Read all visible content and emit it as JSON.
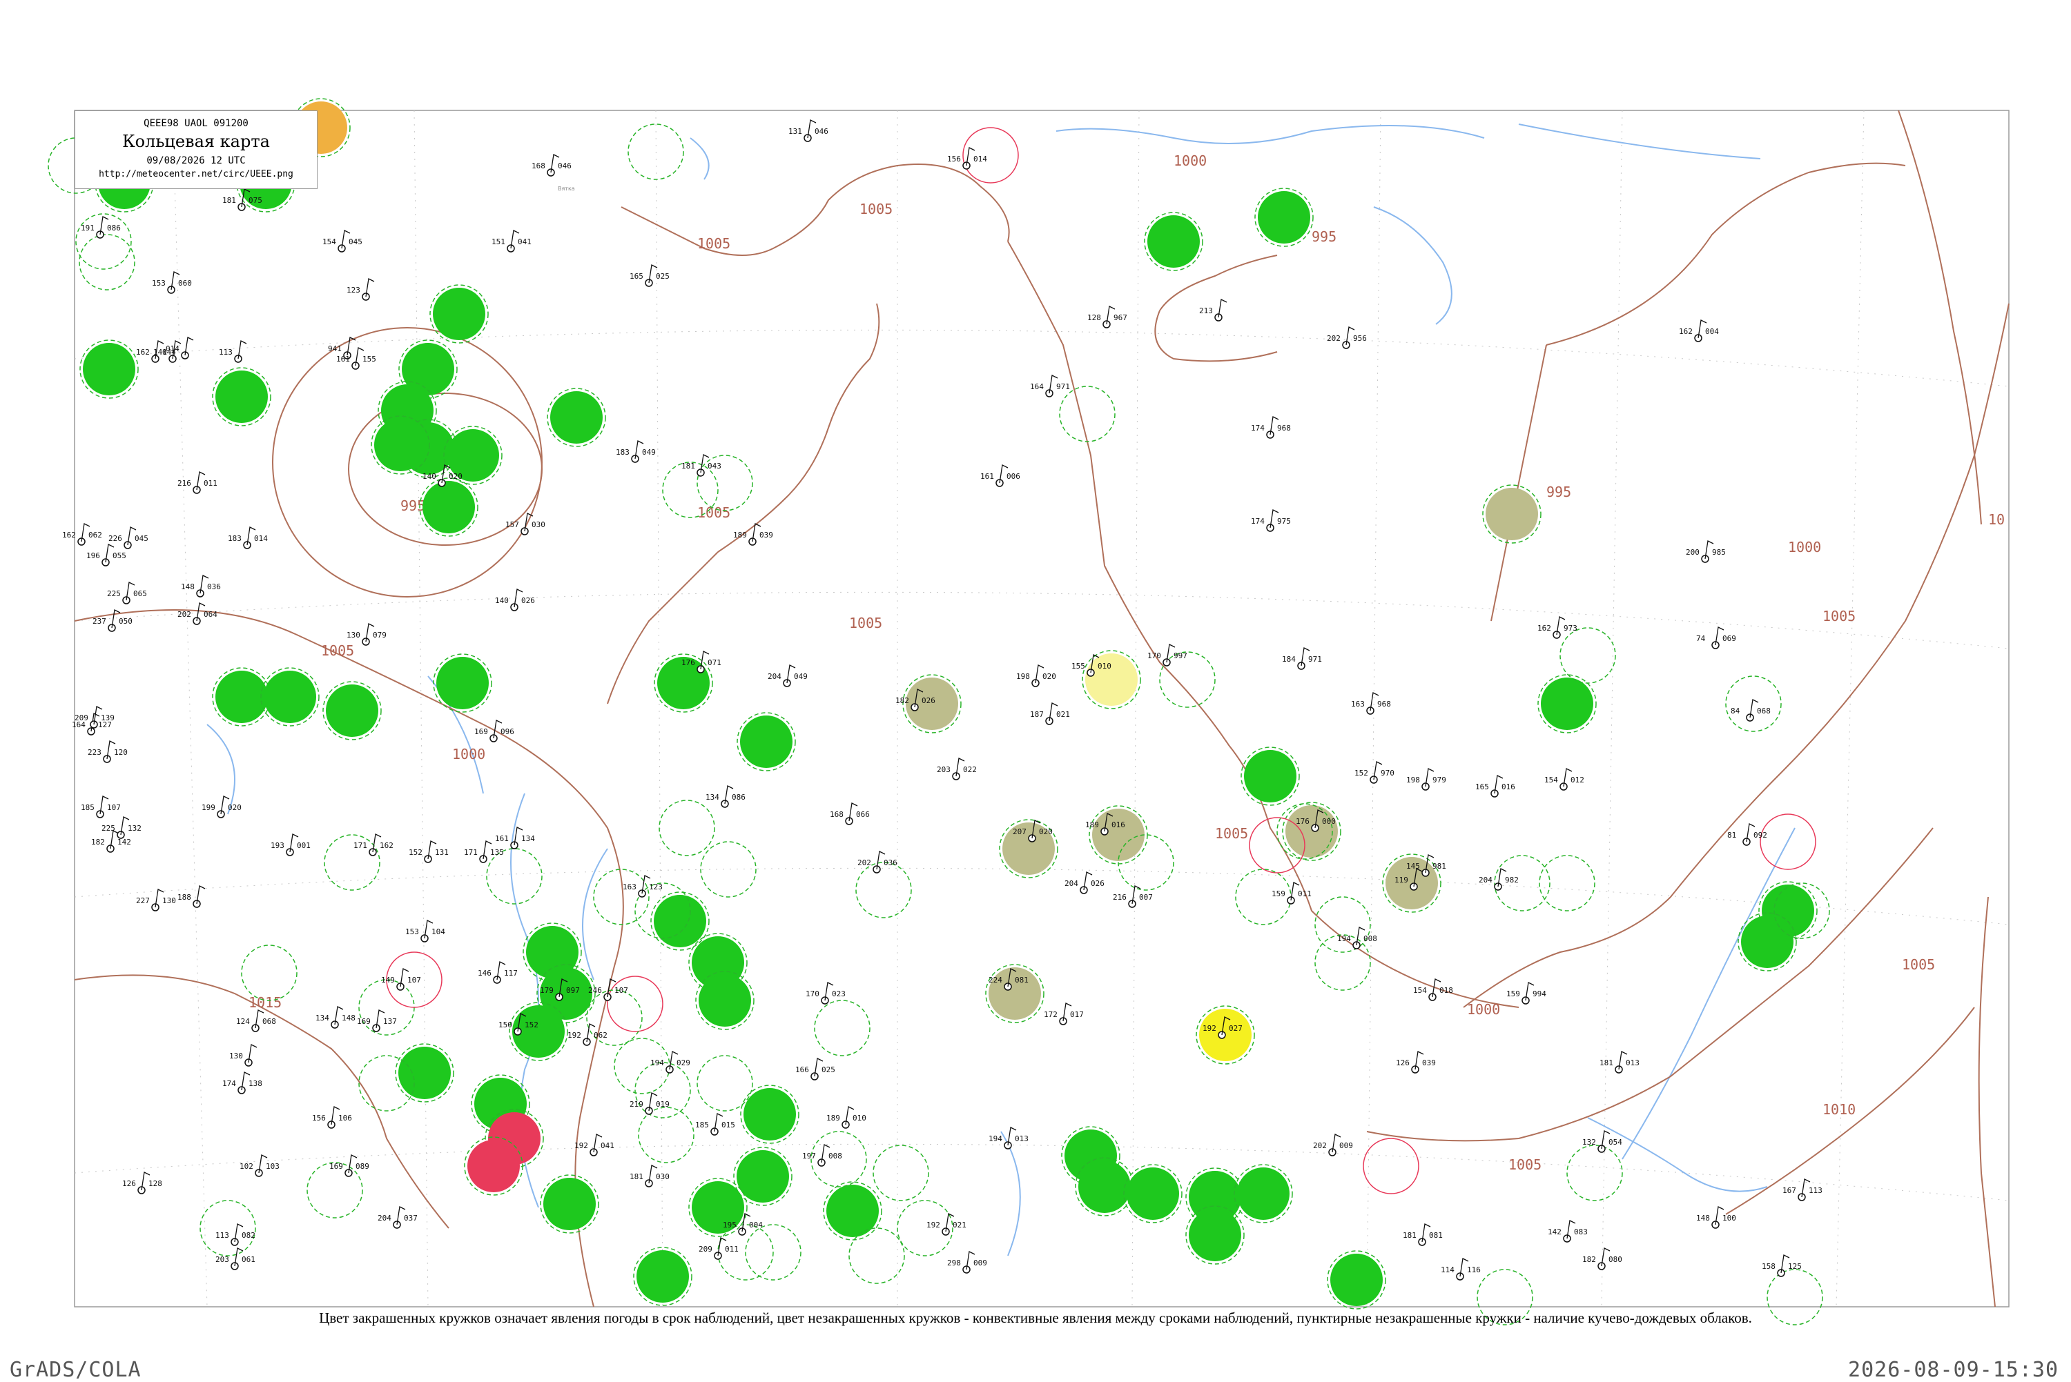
{
  "header": {
    "code_line": "QEEE98  UAOL  091200",
    "title": "Кольцевая карта",
    "date_line": "09/08/2026 12 UTC",
    "url": "http://meteocenter.net/circ/UEEE.png"
  },
  "caption": "Цвет закрашенных кружков означает явления погоды в срок наблюдений, цвет незакрашенных кружков - конвективные явления между сроками наблюдений, пунктирные незакрашенные кружки - наличие кучево-дождевых облаков.",
  "footer": {
    "left": "GrADS/COLA",
    "right": "2026-08-09-15:30"
  },
  "colors": {
    "rain": "#1ec81e",
    "shower_light": "#bdbd8c",
    "fog_yellow": "#f5f020",
    "pale_yellow": "#f7f39a",
    "orange": "#f0b040",
    "red": "#e83a5a",
    "isobar": "#b0705a",
    "water": "#8ab8ee",
    "dash_green": "#29b429"
  },
  "isobar_labels": [
    "1000",
    "1005",
    "1005",
    "1005",
    "1005",
    "1005",
    "1000",
    "995",
    "995",
    "1005",
    "1000",
    "1010",
    "1005",
    "1005",
    "995",
    "1015",
    "1000",
    "1005",
    "10"
  ],
  "stations": [
    {
      "t": "181",
      "p": "075",
      "name": ""
    },
    {
      "t": "191",
      "p": "086",
      "name": ""
    },
    {
      "t": "153",
      "p": "060",
      "name": ""
    },
    {
      "t": "162",
      "p": "044",
      "name": ""
    },
    {
      "t": "154",
      "p": "045",
      "name": ""
    },
    {
      "t": "165",
      "p": "065",
      "name": ""
    },
    {
      "t": "168",
      "p": "046",
      "name": "Вятка"
    },
    {
      "t": "131",
      "p": "046",
      "name": ""
    },
    {
      "t": "156",
      "p": "014",
      "name": ""
    },
    {
      "t": "151",
      "p": "041",
      "name": ""
    },
    {
      "t": "165",
      "p": "025",
      "name": ""
    },
    {
      "t": "941",
      "p": "",
      "name": ""
    },
    {
      "t": "183",
      "p": "049",
      "name": ""
    },
    {
      "t": "181",
      "p": "043",
      "name": ""
    },
    {
      "t": "189",
      "p": "039",
      "name": ""
    },
    {
      "t": "161",
      "p": "006",
      "name": ""
    },
    {
      "t": "164",
      "p": "971",
      "name": ""
    },
    {
      "t": "128",
      "p": "967",
      "name": ""
    },
    {
      "t": "213",
      "p": "",
      "name": ""
    },
    {
      "t": "202",
      "p": "956",
      "name": ""
    },
    {
      "t": "162",
      "p": "004",
      "name": ""
    },
    {
      "t": "174",
      "p": "968",
      "name": ""
    },
    {
      "t": "174",
      "p": "975",
      "name": ""
    },
    {
      "t": "200",
      "p": "985",
      "name": ""
    },
    {
      "t": "216",
      "p": "011",
      "name": ""
    },
    {
      "t": "183",
      "p": "014",
      "name": ""
    },
    {
      "t": "148",
      "p": "036",
      "name": ""
    },
    {
      "t": "157",
      "p": "030",
      "name": ""
    },
    {
      "t": "176",
      "p": "071",
      "name": ""
    },
    {
      "t": "204",
      "p": "049",
      "name": ""
    },
    {
      "t": "198",
      "p": "020",
      "name": ""
    },
    {
      "t": "182",
      "p": "026",
      "name": ""
    },
    {
      "t": "155",
      "p": "010",
      "name": ""
    },
    {
      "t": "170",
      "p": "997",
      "name": ""
    },
    {
      "t": "184",
      "p": "971",
      "name": ""
    },
    {
      "t": "163",
      "p": "968",
      "name": ""
    },
    {
      "t": "162",
      "p": "973",
      "name": ""
    },
    {
      "t": "74",
      "p": "069",
      "name": ""
    },
    {
      "t": "84",
      "p": "068",
      "name": ""
    },
    {
      "t": "225",
      "p": "065",
      "name": ""
    },
    {
      "t": "202",
      "p": "064",
      "name": ""
    },
    {
      "t": "169",
      "p": "096",
      "name": ""
    },
    {
      "t": "130",
      "p": "079",
      "name": ""
    },
    {
      "t": "203",
      "p": "022",
      "name": ""
    },
    {
      "t": "187",
      "p": "021",
      "name": ""
    },
    {
      "t": "207",
      "p": "020",
      "name": ""
    },
    {
      "t": "189",
      "p": "016",
      "name": ""
    },
    {
      "t": "152",
      "p": "970",
      "name": ""
    },
    {
      "t": "198",
      "p": "979",
      "name": ""
    },
    {
      "t": "165",
      "p": "016",
      "name": ""
    },
    {
      "t": "154",
      "p": "012",
      "name": ""
    },
    {
      "t": "81",
      "p": "092",
      "name": ""
    },
    {
      "t": "134",
      "p": "086",
      "name": ""
    },
    {
      "t": "168",
      "p": "066",
      "name": ""
    },
    {
      "t": "202",
      "p": "036",
      "name": ""
    },
    {
      "t": "204",
      "p": "026",
      "name": ""
    },
    {
      "t": "216",
      "p": "007",
      "name": ""
    },
    {
      "t": "176",
      "p": "000",
      "name": ""
    },
    {
      "t": "119",
      "p": "",
      "name": ""
    },
    {
      "t": "145",
      "p": "981",
      "name": ""
    },
    {
      "t": "204",
      "p": "982",
      "name": ""
    },
    {
      "t": "159",
      "p": "011",
      "name": ""
    },
    {
      "t": "194",
      "p": "008",
      "name": ""
    },
    {
      "t": "199",
      "p": "020",
      "name": ""
    },
    {
      "t": "193",
      "p": "001",
      "name": ""
    },
    {
      "t": "171",
      "p": "162",
      "name": ""
    },
    {
      "t": "152",
      "p": "131",
      "name": ""
    },
    {
      "t": "171",
      "p": "135",
      "name": ""
    },
    {
      "t": "161",
      "p": "134",
      "name": ""
    },
    {
      "t": "163",
      "p": "123",
      "name": ""
    },
    {
      "t": "153",
      "p": "104",
      "name": ""
    },
    {
      "t": "179",
      "p": "097",
      "name": ""
    },
    {
      "t": "246",
      "p": "107",
      "name": ""
    },
    {
      "t": "224",
      "p": "081",
      "name": ""
    },
    {
      "t": "170",
      "p": "023",
      "name": ""
    },
    {
      "t": "172",
      "p": "017",
      "name": ""
    },
    {
      "t": "192",
      "p": "027",
      "name": ""
    },
    {
      "t": "154",
      "p": "018",
      "name": ""
    },
    {
      "t": "159",
      "p": "994",
      "name": ""
    },
    {
      "t": "126",
      "p": "039",
      "name": ""
    },
    {
      "t": "181",
      "p": "013",
      "name": ""
    },
    {
      "t": "124",
      "p": "068",
      "name": ""
    },
    {
      "t": "134",
      "p": "148",
      "name": ""
    },
    {
      "t": "169",
      "p": "137",
      "name": ""
    },
    {
      "t": "130",
      "p": "",
      "name": ""
    },
    {
      "t": "146",
      "p": "117",
      "name": ""
    },
    {
      "t": "174",
      "p": "138",
      "name": ""
    },
    {
      "t": "156",
      "p": "106",
      "name": ""
    },
    {
      "t": "149",
      "p": "107",
      "name": ""
    },
    {
      "t": "150",
      "p": "152",
      "name": ""
    },
    {
      "t": "192",
      "p": "062",
      "name": ""
    },
    {
      "t": "194",
      "p": "029",
      "name": ""
    },
    {
      "t": "219",
      "p": "019",
      "name": ""
    },
    {
      "t": "185",
      "p": "015",
      "name": ""
    },
    {
      "t": "166",
      "p": "025",
      "name": ""
    },
    {
      "t": "189",
      "p": "010",
      "name": ""
    },
    {
      "t": "197",
      "p": "008",
      "name": ""
    },
    {
      "t": "192",
      "p": "041",
      "name": ""
    },
    {
      "t": "181",
      "p": "030",
      "name": ""
    },
    {
      "t": "209",
      "p": "011",
      "name": ""
    },
    {
      "t": "195",
      "p": "004",
      "name": ""
    },
    {
      "t": "192",
      "p": "021",
      "name": ""
    },
    {
      "t": "194",
      "p": "013",
      "name": ""
    },
    {
      "t": "202",
      "p": "009",
      "name": ""
    },
    {
      "t": "132",
      "p": "054",
      "name": ""
    },
    {
      "t": "181",
      "p": "081",
      "name": ""
    },
    {
      "t": "142",
      "p": "083",
      "name": ""
    },
    {
      "t": "182",
      "p": "080",
      "name": ""
    },
    {
      "t": "148",
      "p": "100",
      "name": ""
    },
    {
      "t": "167",
      "p": "113",
      "name": ""
    },
    {
      "t": "158",
      "p": "125",
      "name": ""
    },
    {
      "t": "114",
      "p": "116",
      "name": ""
    },
    {
      "t": "102",
      "p": "103",
      "name": ""
    },
    {
      "t": "126",
      "p": "128",
      "name": ""
    },
    {
      "t": "113",
      "p": "082",
      "name": ""
    },
    {
      "t": "203",
      "p": "061",
      "name": ""
    },
    {
      "t": "204",
      "p": "037",
      "name": ""
    },
    {
      "t": "298",
      "p": "009",
      "name": ""
    },
    {
      "t": "169",
      "p": "089",
      "name": ""
    },
    {
      "t": "188",
      "p": "",
      "name": ""
    },
    {
      "t": "227",
      "p": "130",
      "name": ""
    },
    {
      "t": "182",
      "p": "142",
      "name": ""
    },
    {
      "t": "225",
      "p": "132",
      "name": ""
    },
    {
      "t": "164",
      "p": "127",
      "name": ""
    },
    {
      "t": "209",
      "p": "139",
      "name": ""
    },
    {
      "t": "223",
      "p": "120",
      "name": ""
    },
    {
      "t": "185",
      "p": "107",
      "name": ""
    },
    {
      "t": "237",
      "p": "050",
      "name": ""
    },
    {
      "t": "196",
      "p": "055",
      "name": ""
    },
    {
      "t": "162",
      "p": "062",
      "name": ""
    },
    {
      "t": "226",
      "p": "045",
      "name": ""
    },
    {
      "t": "140",
      "p": "020",
      "name": ""
    },
    {
      "t": "140",
      "p": "026",
      "name": ""
    },
    {
      "t": "123",
      "p": "",
      "name": ""
    },
    {
      "t": "161",
      "p": "155",
      "name": ""
    },
    {
      "t": "113",
      "p": "",
      "name": ""
    },
    {
      "t": "014",
      "p": "",
      "name": ""
    },
    {
      "t": "141",
      "p": "",
      "name": ""
    }
  ]
}
